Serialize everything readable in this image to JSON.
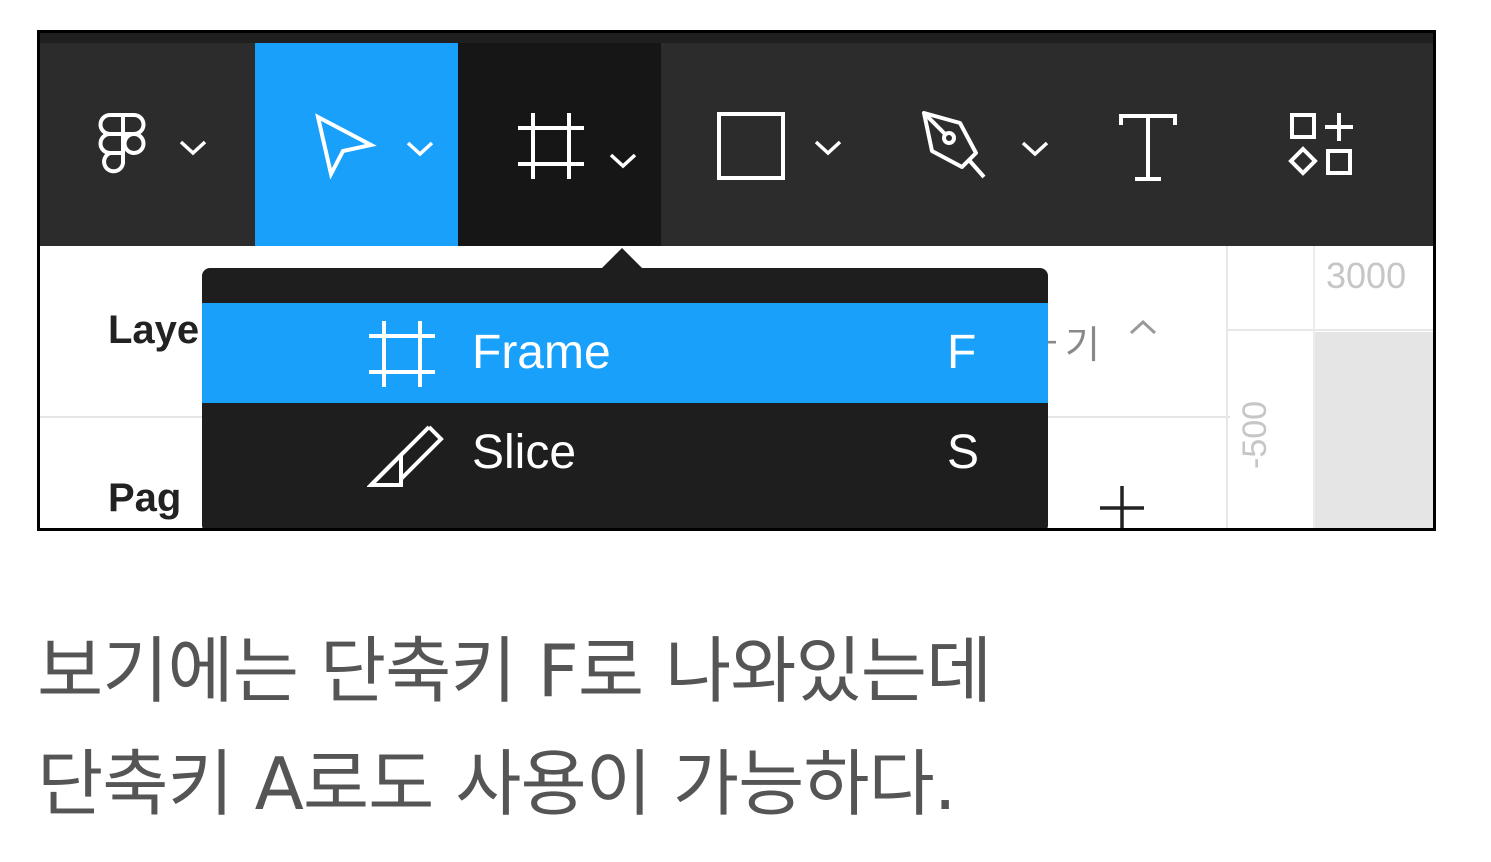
{
  "toolbar": {
    "tools": [
      {
        "name": "main-menu",
        "icon": "figma-logo-icon"
      },
      {
        "name": "move",
        "icon": "cursor-icon",
        "state": "selected"
      },
      {
        "name": "frame",
        "icon": "frame-icon",
        "state": "open"
      },
      {
        "name": "shape",
        "icon": "rectangle-icon"
      },
      {
        "name": "pen",
        "icon": "pen-icon"
      },
      {
        "name": "text",
        "icon": "text-icon"
      },
      {
        "name": "resources",
        "icon": "resources-icon"
      }
    ]
  },
  "panel": {
    "layers_label": "Laye",
    "pages_label": "Pag",
    "korean_fragment": "ㅏ기"
  },
  "canvas": {
    "ruler_top_value": "3000",
    "ruler_left_value": "-500"
  },
  "dropdown": {
    "items": [
      {
        "label": "Frame",
        "shortcut": "F",
        "icon": "frame-icon",
        "active": true
      },
      {
        "label": "Slice",
        "shortcut": "S",
        "icon": "slice-icon",
        "active": false
      }
    ]
  },
  "caption": {
    "line1": "보기에는 단축키 F로 나와있는데",
    "line2": "단축키 A로도 사용이 가능하다."
  },
  "colors": {
    "toolbar_bg": "#2c2c2c",
    "accent_blue": "#18a0fb",
    "frame_tool_bg": "#161616",
    "dropdown_bg": "#1e1e1e"
  }
}
